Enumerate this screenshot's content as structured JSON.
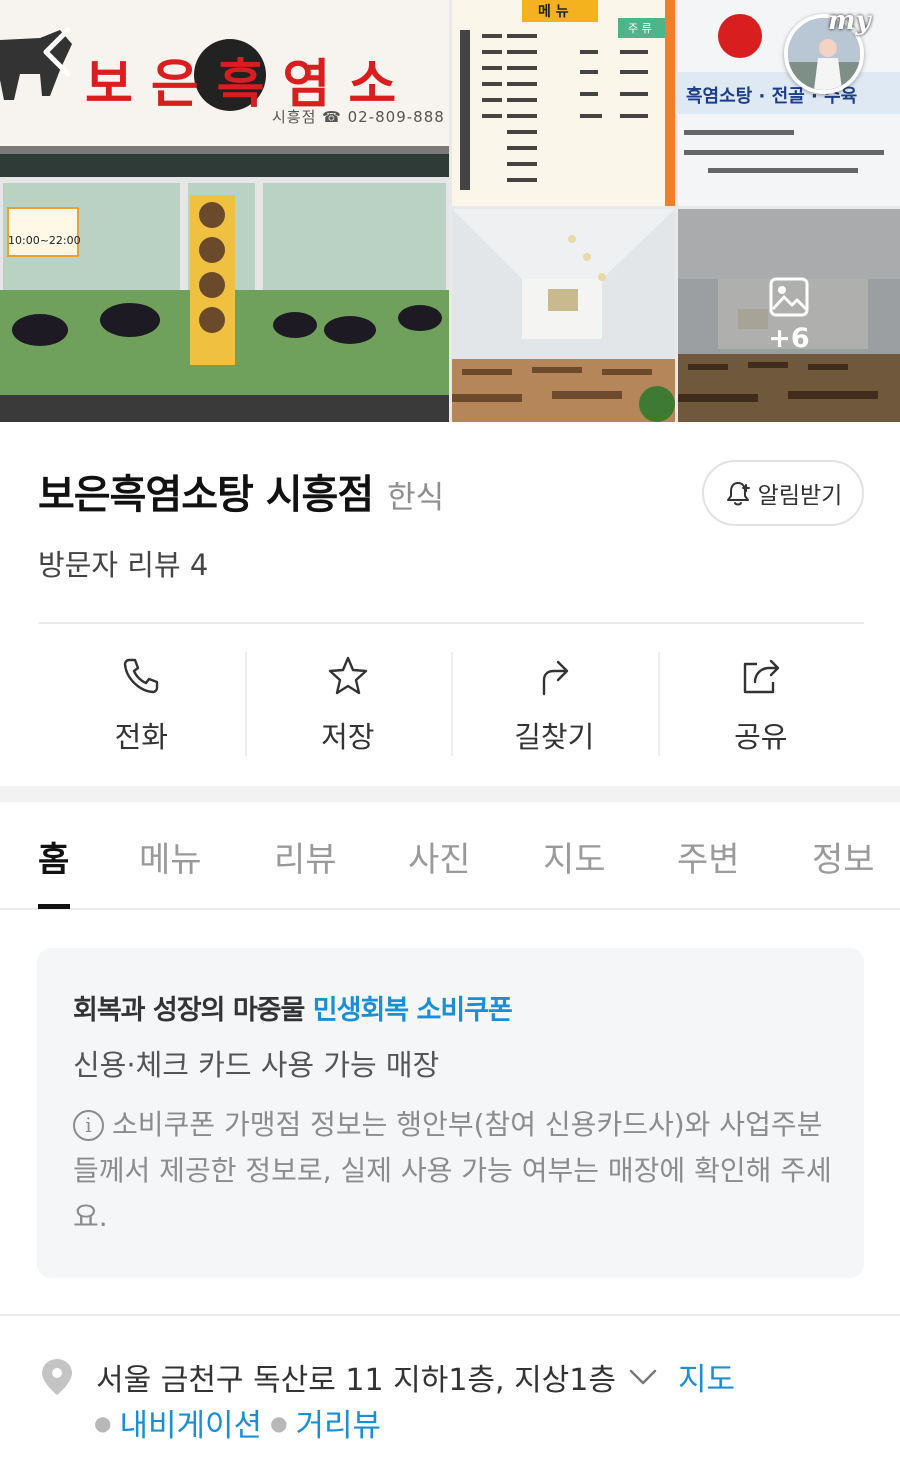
{
  "photos": {
    "storefront_sign": "보은흑염소",
    "storefront_sub": "시흥점 ☎ 02-809-888",
    "hours": "10:00~22:00",
    "menu_header": "메 뉴",
    "menu_drinks_header": "주 류",
    "sign2_line": "흑염소탕 · 전골 · 수육",
    "more_count": "+6",
    "my_label": "my"
  },
  "place": {
    "name": "보은흑염소탕 시흥점",
    "category": "한식",
    "review_label": "방문자 리뷰 4",
    "notify_label": "알림받기"
  },
  "actions": [
    {
      "label": "전화",
      "icon": "phone-icon"
    },
    {
      "label": "저장",
      "icon": "star-icon"
    },
    {
      "label": "길찾기",
      "icon": "directions-icon"
    },
    {
      "label": "공유",
      "icon": "share-icon"
    }
  ],
  "tabs": [
    "홈",
    "메뉴",
    "리뷰",
    "사진",
    "지도",
    "주변",
    "정보"
  ],
  "coupon": {
    "title_prefix": "회복과 성장의 마중물",
    "title_highlight": "민생회복 소비쿠폰",
    "subtitle": "신용·체크 카드 사용 가능 매장",
    "note": "소비쿠폰 가맹점 정보는 행안부(참여 신용카드사)와 사업주분들께서 제공한 정보로, 실제 사용 가능 여부는 매장에 확인해 주세요."
  },
  "address": {
    "text": "서울 금천구 독산로 11 지하1층, 지상1층",
    "map_link": "지도",
    "navigation_link": "내비게이션",
    "streetview_link": "거리뷰"
  },
  "colors": {
    "accent": "#1a8fd8",
    "text_primary": "#111111",
    "text_muted": "#8c8c8c",
    "card_bg": "#f5f6f8"
  }
}
